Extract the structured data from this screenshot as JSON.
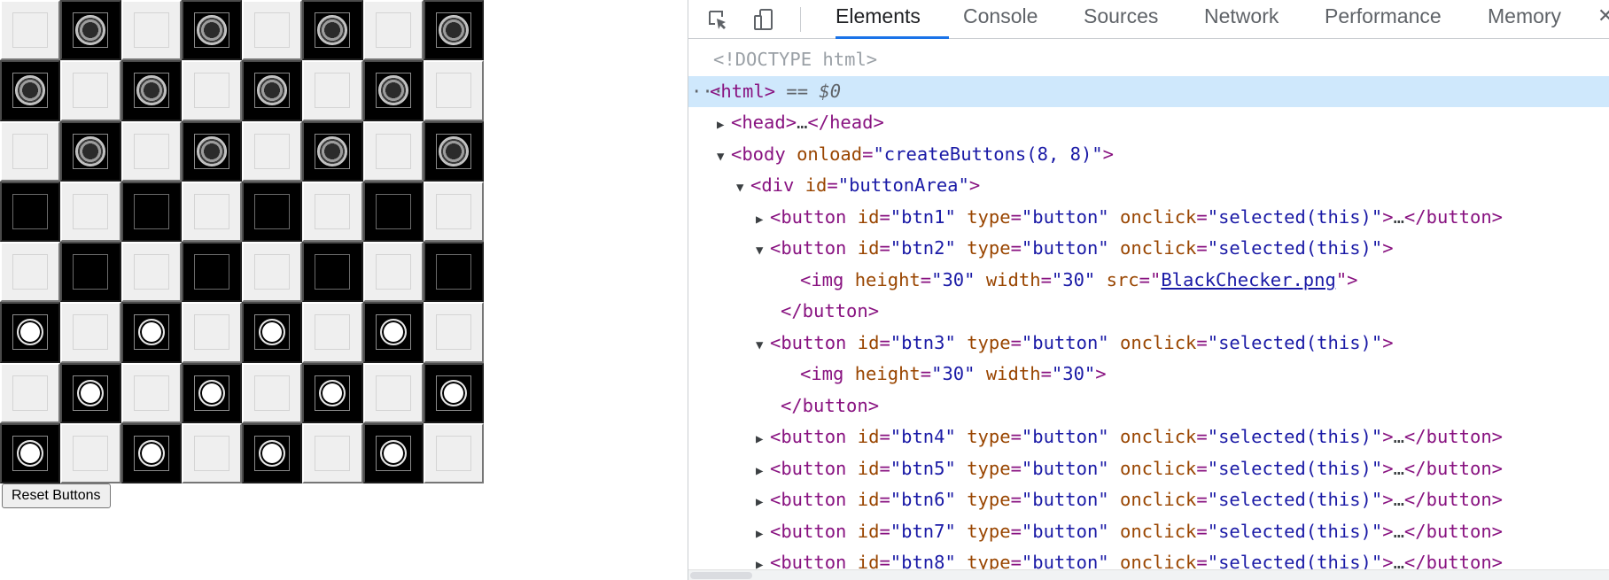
{
  "board": {
    "rows": 8,
    "cols": 8,
    "layout": [
      "-b-b-b-b",
      "b-b-b-b-",
      "-b-b-b-b",
      "e-e-e-e-",
      "-e-e-e-e",
      "w-w-w-w-",
      "-w-w-w-w",
      "w-w-w-w-"
    ],
    "legend": {
      "b": "black-checker",
      "w": "white-checker",
      "e": "empty-dark",
      "-": "empty-light"
    }
  },
  "reset_button": {
    "label": "Reset Buttons"
  },
  "devtools": {
    "tabs": [
      {
        "label": "Elements",
        "active": true
      },
      {
        "label": "Console",
        "active": false
      },
      {
        "label": "Sources",
        "active": false
      },
      {
        "label": "Network",
        "active": false
      },
      {
        "label": "Performance",
        "active": false
      },
      {
        "label": "Memory",
        "active": false
      }
    ],
    "overflow_glyph": "✕",
    "tree": {
      "doctype": "<!DOCTYPE html>",
      "html": {
        "gutter": "···",
        "open": "<html>",
        "marker": " == $0"
      },
      "head": {
        "open": "<head>",
        "ellipsis": "…",
        "close": "</head>"
      },
      "body": {
        "tag": "body",
        "attr": "onload",
        "value": "\"createButtons(8, 8)\""
      },
      "div": {
        "tag": "div",
        "attr": "id",
        "value": "\"buttonArea\""
      },
      "buttons": [
        {
          "id": "\"btn1\"",
          "expanded": false
        },
        {
          "id": "\"btn2\"",
          "expanded": true,
          "img": {
            "height": "\"30\"",
            "width": "\"30\"",
            "src": "BlackChecker.png"
          }
        },
        {
          "id": "\"btn3\"",
          "expanded": true,
          "img": {
            "height": "\"30\"",
            "width": "\"30\""
          }
        },
        {
          "id": "\"btn4\"",
          "expanded": false
        },
        {
          "id": "\"btn5\"",
          "expanded": false
        },
        {
          "id": "\"btn6\"",
          "expanded": false
        },
        {
          "id": "\"btn7\"",
          "expanded": false
        },
        {
          "id": "\"btn8\"",
          "expanded": false
        }
      ],
      "button_type": "\"button\"",
      "button_onclick": "\"selected(this)\"",
      "ellipsis": "…",
      "close_button": "</button>"
    }
  }
}
